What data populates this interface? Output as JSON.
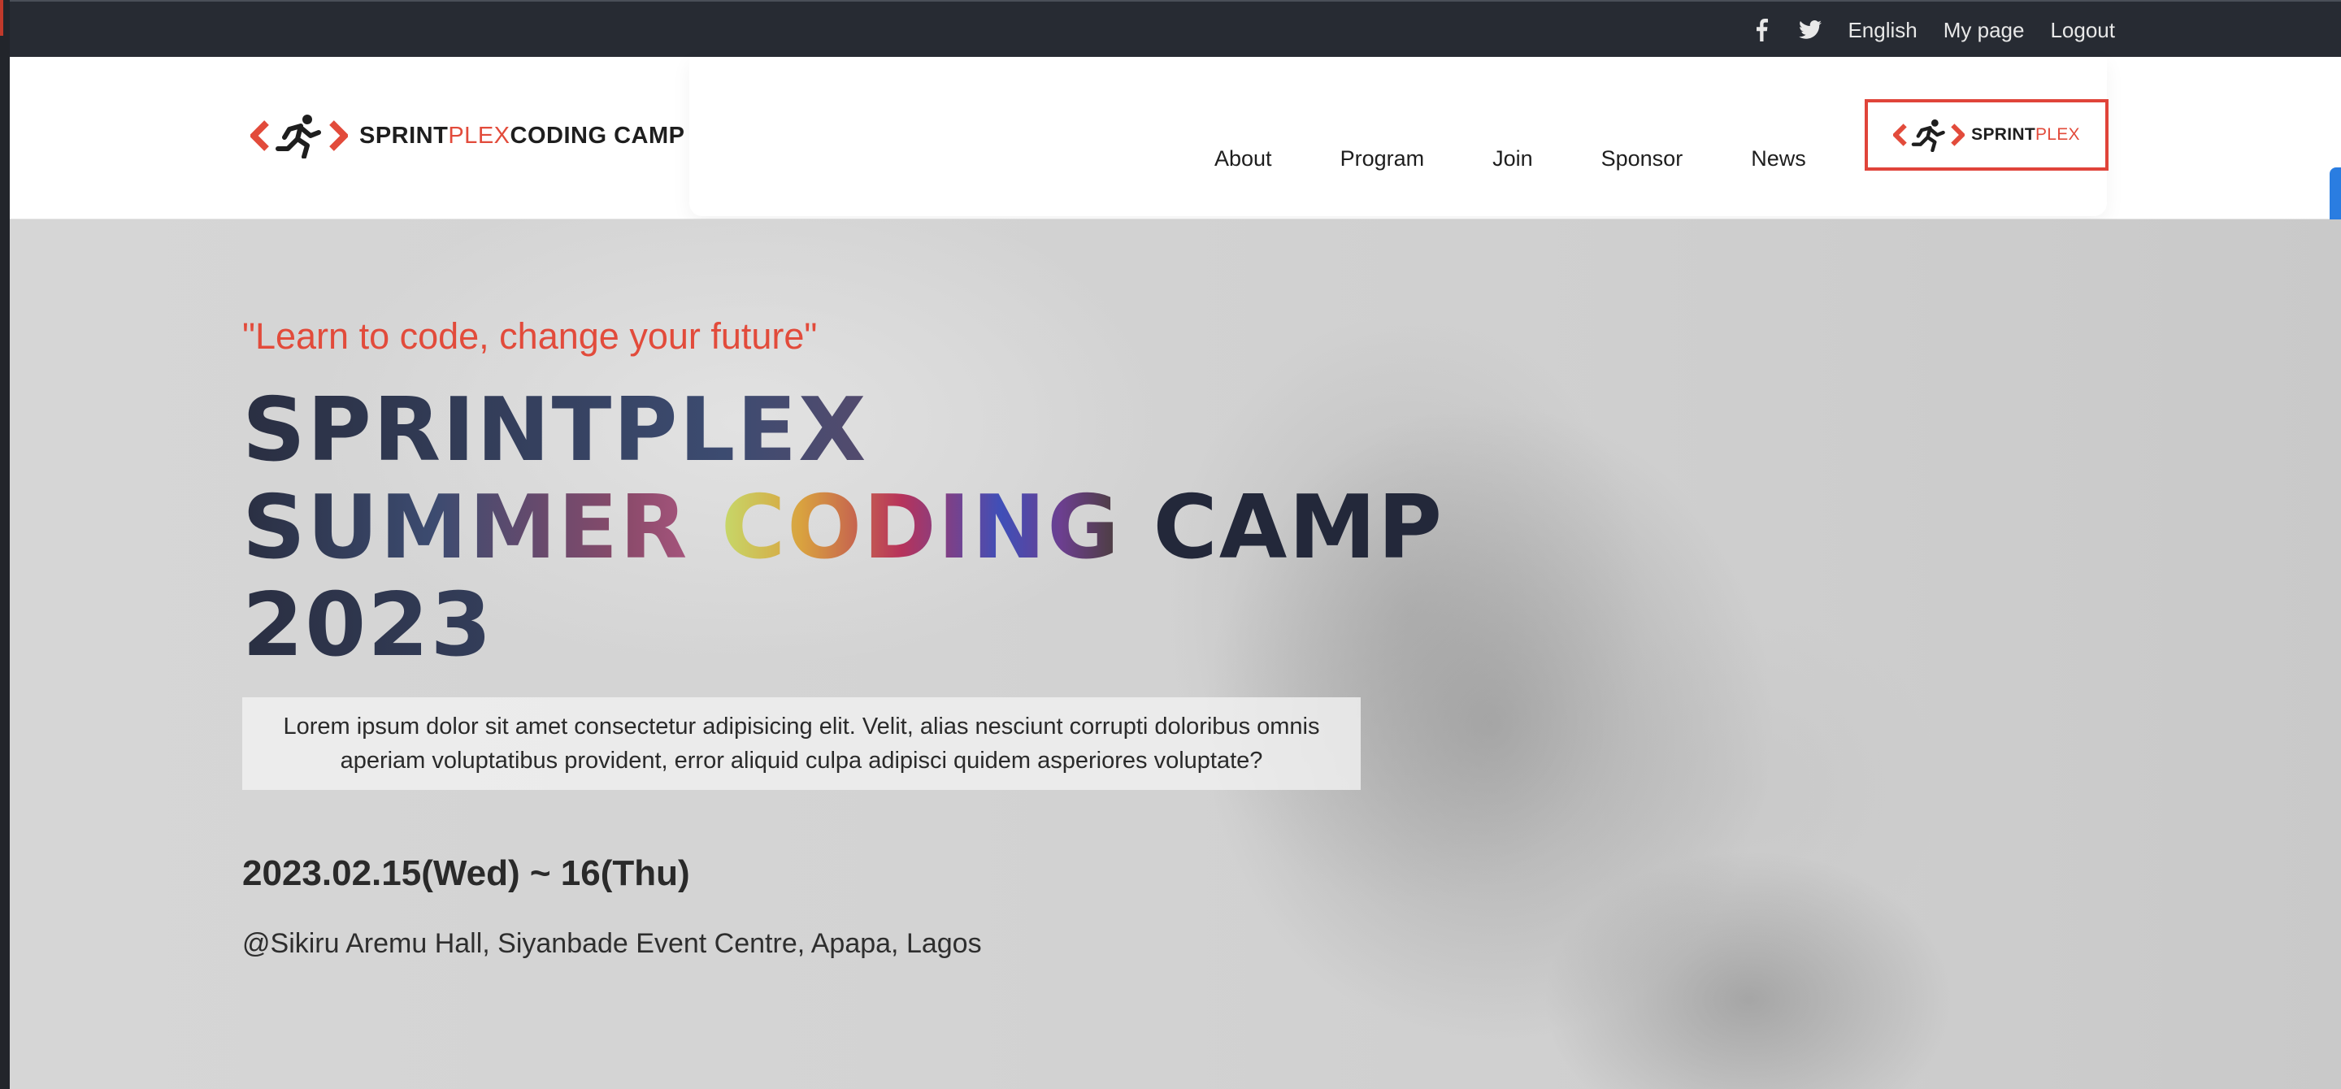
{
  "topbar": {
    "icons": [
      "facebook-icon",
      "twitter-icon"
    ],
    "language": "English",
    "my_page": "My page",
    "logout": "Logout"
  },
  "brand": {
    "part1": "SPRINT",
    "part2": "PLEX",
    "part3": "CODING CAMP"
  },
  "nav": {
    "items": [
      "About",
      "Program",
      "Join",
      "Sponsor",
      "News"
    ]
  },
  "sponsor_badge": {
    "part1": "SPRINT",
    "part2": "PLEX"
  },
  "hero": {
    "tagline": "\"Learn to code, change your future\"",
    "title_line1": "SPRINTPLEX",
    "title_line2a": "SUMMER ",
    "title_line2b": "CODING",
    "title_line2c": " CAMP",
    "title_line3": "2023",
    "description": "Lorem ipsum dolor sit amet consectetur adipisicing elit. Velit, alias nesciunt corrupti doloribus omnis aperiam voluptatibus provident, error aliquid culpa adipisci quidem asperiores voluptate?",
    "date": "2023.02.15(Wed) ~ 16(Thu)",
    "venue": "@Sikiru Aremu Hall, Siyanbade Event Centre, Apapa, Lagos"
  },
  "colors": {
    "accent": "#e24b3b",
    "topbar_bg": "#272b33",
    "title": "#23283a"
  }
}
